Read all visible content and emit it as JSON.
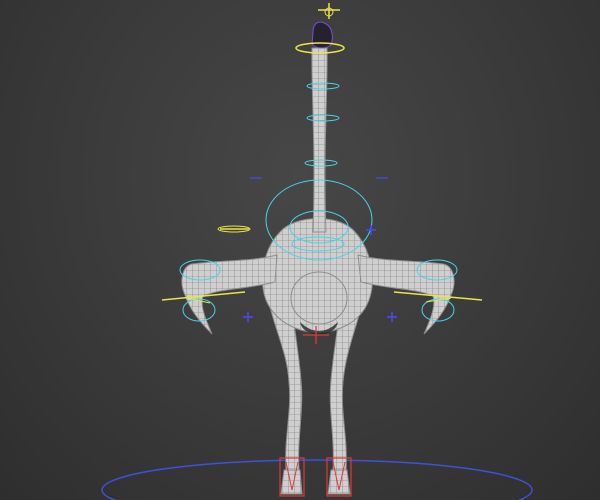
{
  "viewport": {
    "background": "#3b3b3b",
    "mesh_color": "#c8c8c8",
    "wire_color": "#6e6e6e",
    "control_colors": {
      "cyan": "#47d3e6",
      "yellow": "#e8e44a",
      "blue": "#4b4bf0",
      "red": "#e03a3a",
      "ground": "#3d52d6"
    }
  },
  "rig": {
    "model": "ostrich",
    "view": "front",
    "display": "wireframe-on-shaded",
    "controls": [
      "head-locator",
      "head-control",
      "neck-controls",
      "chest-control",
      "wing-controls-left",
      "wing-controls-right",
      "pole-vectors",
      "hip-root-control",
      "leg-ik-controls",
      "world-ground-control"
    ]
  }
}
